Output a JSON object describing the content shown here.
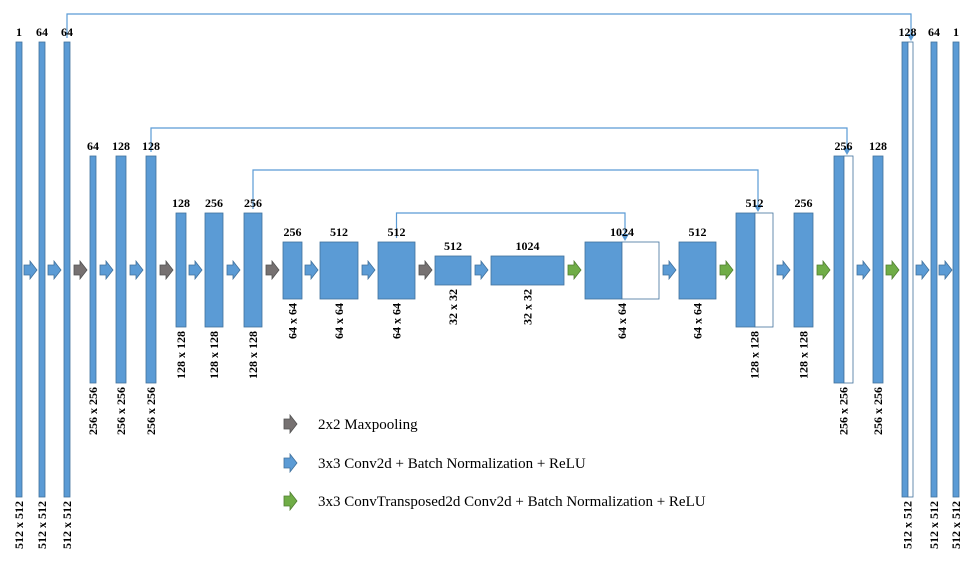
{
  "colors": {
    "block": "#5b9bd5",
    "block_stroke": "#41719c",
    "skip_line": "#5b9bd5",
    "maxpool": "#767171",
    "conv": "#5b9bd5",
    "upconv": "#70ad47"
  },
  "layers": [
    {
      "id": "e1a",
      "channels": "1",
      "size": "512 x 512"
    },
    {
      "id": "e1b",
      "channels": "64",
      "size": "512 x 512"
    },
    {
      "id": "e1c",
      "channels": "64",
      "size": "512 x 512"
    },
    {
      "id": "e2a",
      "channels": "64",
      "size": "256 x 256"
    },
    {
      "id": "e2b",
      "channels": "128",
      "size": "256 x 256"
    },
    {
      "id": "e2c",
      "channels": "128",
      "size": "256 x 256"
    },
    {
      "id": "e3a",
      "channels": "128",
      "size": "128 x 128"
    },
    {
      "id": "e3b",
      "channels": "256",
      "size": "128 x 128"
    },
    {
      "id": "e3c",
      "channels": "256",
      "size": "128 x 128"
    },
    {
      "id": "e4a",
      "channels": "256",
      "size": "64 x 64"
    },
    {
      "id": "e4b",
      "channels": "512",
      "size": "64 x 64"
    },
    {
      "id": "e4c",
      "channels": "512",
      "size": "64 x 64"
    },
    {
      "id": "b1",
      "channels": "512",
      "size": "32 x 32"
    },
    {
      "id": "b2",
      "channels": "1024",
      "size": "32 x 32"
    },
    {
      "id": "d4a",
      "channels": "1024",
      "size": "64 x 64",
      "concat": true
    },
    {
      "id": "d4b",
      "channels": "512",
      "size": "64 x 64"
    },
    {
      "id": "d3a",
      "channels": "512",
      "size": "128 x 128",
      "concat": true
    },
    {
      "id": "d3b",
      "channels": "256",
      "size": "128 x 128"
    },
    {
      "id": "d2a",
      "channels": "256",
      "size": "256 x 256",
      "concat": true
    },
    {
      "id": "d2b",
      "channels": "128",
      "size": "256 x 256"
    },
    {
      "id": "d1a",
      "channels": "128",
      "size": "512 x 512",
      "concat": true
    },
    {
      "id": "d1b",
      "channels": "64",
      "size": "512 x 512"
    },
    {
      "id": "d1c",
      "channels": "1",
      "size": "512 x 512"
    }
  ],
  "skips": [
    {
      "from": "e1c",
      "to": "d1a"
    },
    {
      "from": "e2c",
      "to": "d2a"
    },
    {
      "from": "e3c",
      "to": "d3a"
    },
    {
      "from": "e4c",
      "to": "d4a"
    }
  ],
  "arrows": [
    "conv",
    "conv",
    "maxpool",
    "conv",
    "conv",
    "maxpool",
    "conv",
    "conv",
    "maxpool",
    "conv",
    "conv",
    "maxpool",
    "conv",
    "upconv",
    "conv",
    "upconv",
    "conv",
    "upconv",
    "conv",
    "upconv",
    "conv",
    "conv"
  ],
  "legend": [
    {
      "kind": "maxpool",
      "label": "2x2 Maxpooling"
    },
    {
      "kind": "conv",
      "label": "3x3 Conv2d + Batch Normalization + ReLU"
    },
    {
      "kind": "upconv",
      "label": "3x3 ConvTransposed2d Conv2d + Batch Normalization + ReLU"
    }
  ]
}
